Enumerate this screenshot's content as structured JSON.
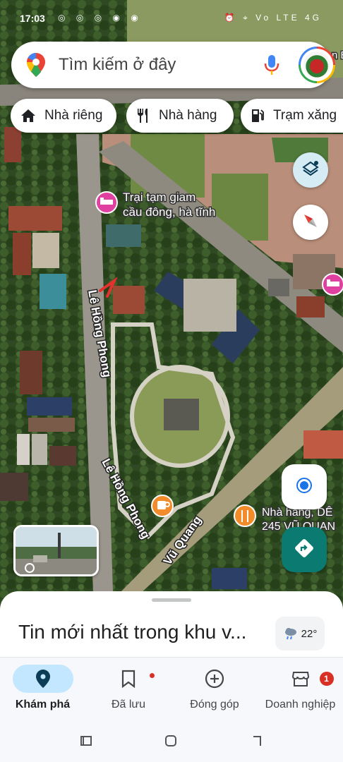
{
  "status_bar": {
    "time": "17:03",
    "left_icons": "◎ ◎ ◎ ◉ ◉",
    "right_icons": "⏰ ⌖ Vo LTE 4G"
  },
  "search": {
    "placeholder": "Tìm kiếm ở đây"
  },
  "chips": [
    {
      "label": "Nhà riêng",
      "icon": "home-icon"
    },
    {
      "label": "Nhà hàng",
      "icon": "restaurant-icon"
    },
    {
      "label": "Trạm xăng",
      "icon": "gas-station-icon"
    }
  ],
  "map": {
    "poi_jail_line1": "Trại tạm giam",
    "poi_jail_line2": "cầu đông, hà tĩnh",
    "poi_restaurant_line1": "Nhà hàng, DÊ",
    "poi_restaurant_line2": "245 VŨ QUAN",
    "road_1": "Lê Hồng Phong",
    "road_2": "Lê Hồng Phong",
    "road_3": "Vũ Quang",
    "top_right_fragment": "n B",
    "colors": {
      "hotel_pin": "#e040a0",
      "restaurant_pin": "#f28b29",
      "accent_blue": "#1a73e8",
      "directions_teal": "#0b7a70"
    }
  },
  "sheet": {
    "title": "Tin mới nhất trong khu v...",
    "temperature": "22°"
  },
  "nav": [
    {
      "label": "Khám phá",
      "icon": "explore-pin-icon"
    },
    {
      "label": "Đã lưu",
      "icon": "bookmark-icon"
    },
    {
      "label": "Đóng góp",
      "icon": "add-circle-icon"
    },
    {
      "label": "Doanh nghiệp",
      "icon": "storefront-icon",
      "badge": "1"
    }
  ]
}
